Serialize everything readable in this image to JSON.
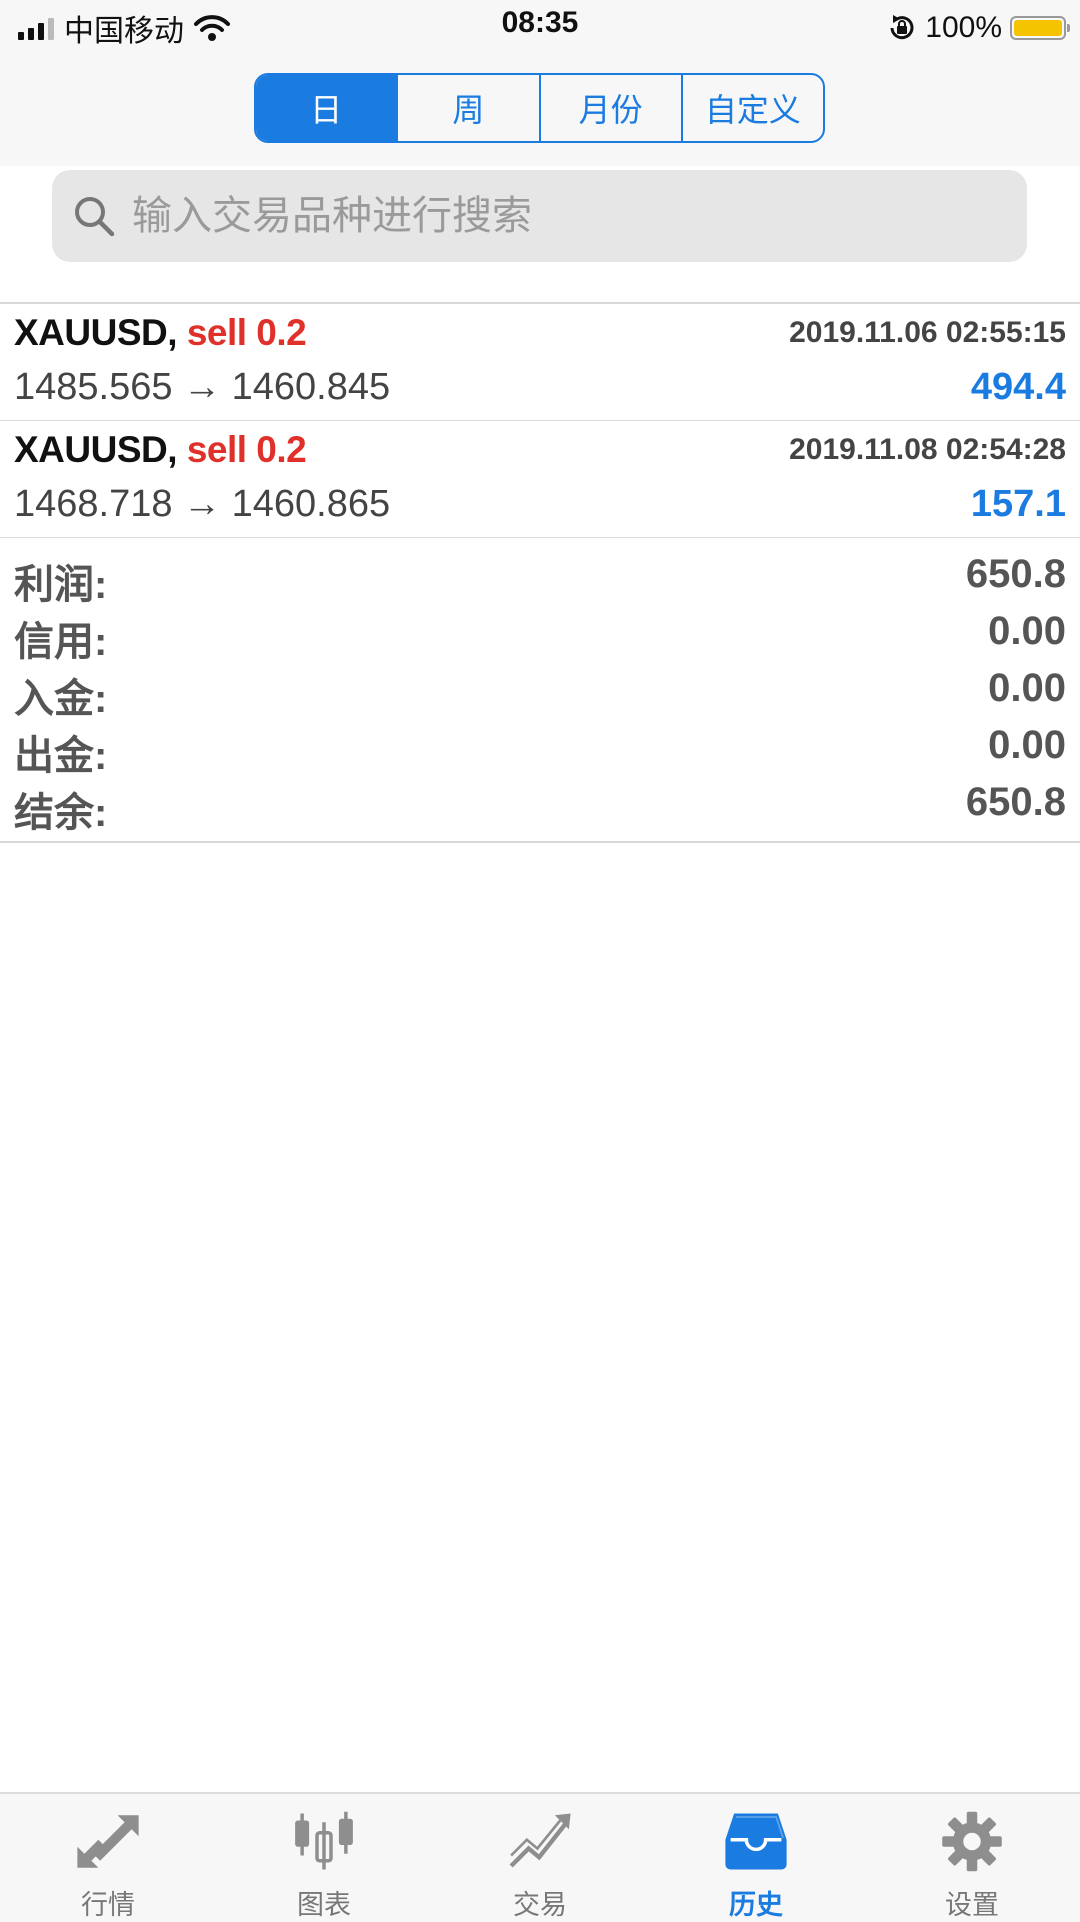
{
  "status_bar": {
    "carrier": "中国移动",
    "time": "08:35",
    "battery": "100%",
    "battery_color": "#f5c400"
  },
  "period_tabs": [
    {
      "label": "日",
      "active": true
    },
    {
      "label": "周",
      "active": false
    },
    {
      "label": "月份",
      "active": false
    },
    {
      "label": "自定义",
      "active": false
    }
  ],
  "search": {
    "placeholder": "输入交易品种进行搜索",
    "icon": "search-icon"
  },
  "trades": [
    {
      "symbol": "XAUUSD,",
      "side": "sell 0.2",
      "time": "2019.11.06 02:55:15",
      "prices": "1485.565 → 1460.845",
      "profit": "494.4"
    },
    {
      "symbol": "XAUUSD,",
      "side": "sell 0.2",
      "time": "2019.11.08 02:54:28",
      "prices": "1468.718 → 1460.865",
      "profit": "157.1"
    }
  ],
  "summary": [
    {
      "label": "利润:",
      "value": "650.8"
    },
    {
      "label": "信用:",
      "value": "0.00"
    },
    {
      "label": "入金:",
      "value": "0.00"
    },
    {
      "label": "出金:",
      "value": "0.00"
    },
    {
      "label": "结余:",
      "value": "650.8"
    }
  ],
  "tab_bar": [
    {
      "label": "行情",
      "icon": "quotes-arrows-icon",
      "active": false
    },
    {
      "label": "图表",
      "icon": "candlestick-chart-icon",
      "active": false
    },
    {
      "label": "交易",
      "icon": "trade-trend-icon",
      "active": false
    },
    {
      "label": "历史",
      "icon": "history-inbox-icon",
      "active": true
    },
    {
      "label": "设置",
      "icon": "gear-icon",
      "active": false
    }
  ],
  "colors": {
    "accent": "#1a7be0",
    "sell": "#e0302a",
    "inactive_icon": "#8e8e8e"
  }
}
